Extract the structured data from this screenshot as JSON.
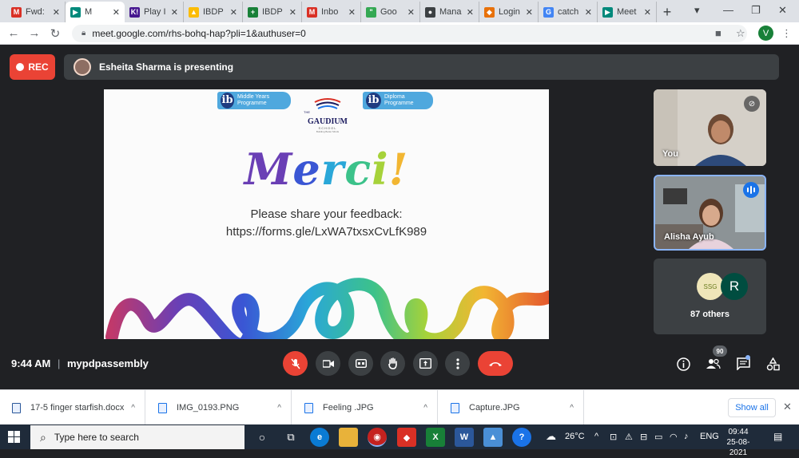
{
  "browser": {
    "tabs": [
      {
        "label": "Fwd:",
        "icon": "gmail-icon",
        "color": "#d93025",
        "glyph": "M"
      },
      {
        "label": "M",
        "icon": "meet-icon",
        "color": "#00897b",
        "glyph": "▶",
        "active": true
      },
      {
        "label": "Play I",
        "icon": "kahoot-icon",
        "color": "#46178f",
        "glyph": "K!"
      },
      {
        "label": "IBDP",
        "icon": "drive-icon",
        "color": "#fbbc04",
        "glyph": "▲"
      },
      {
        "label": "IBDP",
        "icon": "sheets-icon",
        "color": "#188038",
        "glyph": "+"
      },
      {
        "label": "Inbo",
        "icon": "gmail-icon",
        "color": "#d93025",
        "glyph": "M"
      },
      {
        "label": "Goo",
        "icon": "hangouts-icon",
        "color": "#34a853",
        "glyph": "\""
      },
      {
        "label": "Mana",
        "icon": "globe-icon",
        "color": "#3c4043",
        "glyph": "●"
      },
      {
        "label": "Login",
        "icon": "shield-icon",
        "color": "#e8710a",
        "glyph": "◆"
      },
      {
        "label": "catch",
        "icon": "google-icon",
        "color": "#4285f4",
        "glyph": "G"
      },
      {
        "label": "Meet",
        "icon": "meet-icon",
        "color": "#00897b",
        "glyph": "▶"
      }
    ],
    "new_tab": "+",
    "url": "meet.google.com/rhs-bohq-hap?pli=1&authuser=0",
    "profile_initial": "V"
  },
  "meet": {
    "rec_label": "REC",
    "presenting_text": "Esheita Sharma is presenting",
    "slide": {
      "badge_left": "Middle Years Programme",
      "badge_right": "Diploma Programme",
      "ib_glyph": "ib",
      "school_the": "THE",
      "school_name": "GAUDIUM",
      "school_word": "SCHOOL",
      "school_tagline": "Building Better Minds",
      "title": "Merci!",
      "feedback_text": "Please share your feedback:",
      "form_url": "https://forms.gle/LxWA7txsxCvLfK989"
    },
    "tiles": {
      "you_label": "You",
      "alisha_label": "Alisha Ayub",
      "others_avatar_1": "SSG",
      "others_avatar_2": "R",
      "others_count": "87 others"
    },
    "time": "9:44 AM",
    "separator": "|",
    "meeting_code": "mypdpassembly",
    "participant_count": "90"
  },
  "downloads": [
    {
      "name": "17-5 finger starfish.docx"
    },
    {
      "name": "IMG_0193.PNG"
    },
    {
      "name": "Feeling .JPG"
    },
    {
      "name": "Capture.JPG"
    }
  ],
  "show_all": "Show all",
  "taskbar": {
    "search_placeholder": "Type here to search",
    "temperature": "26°C",
    "language": "ENG",
    "time": "09:44",
    "date": "25-08-2021"
  }
}
